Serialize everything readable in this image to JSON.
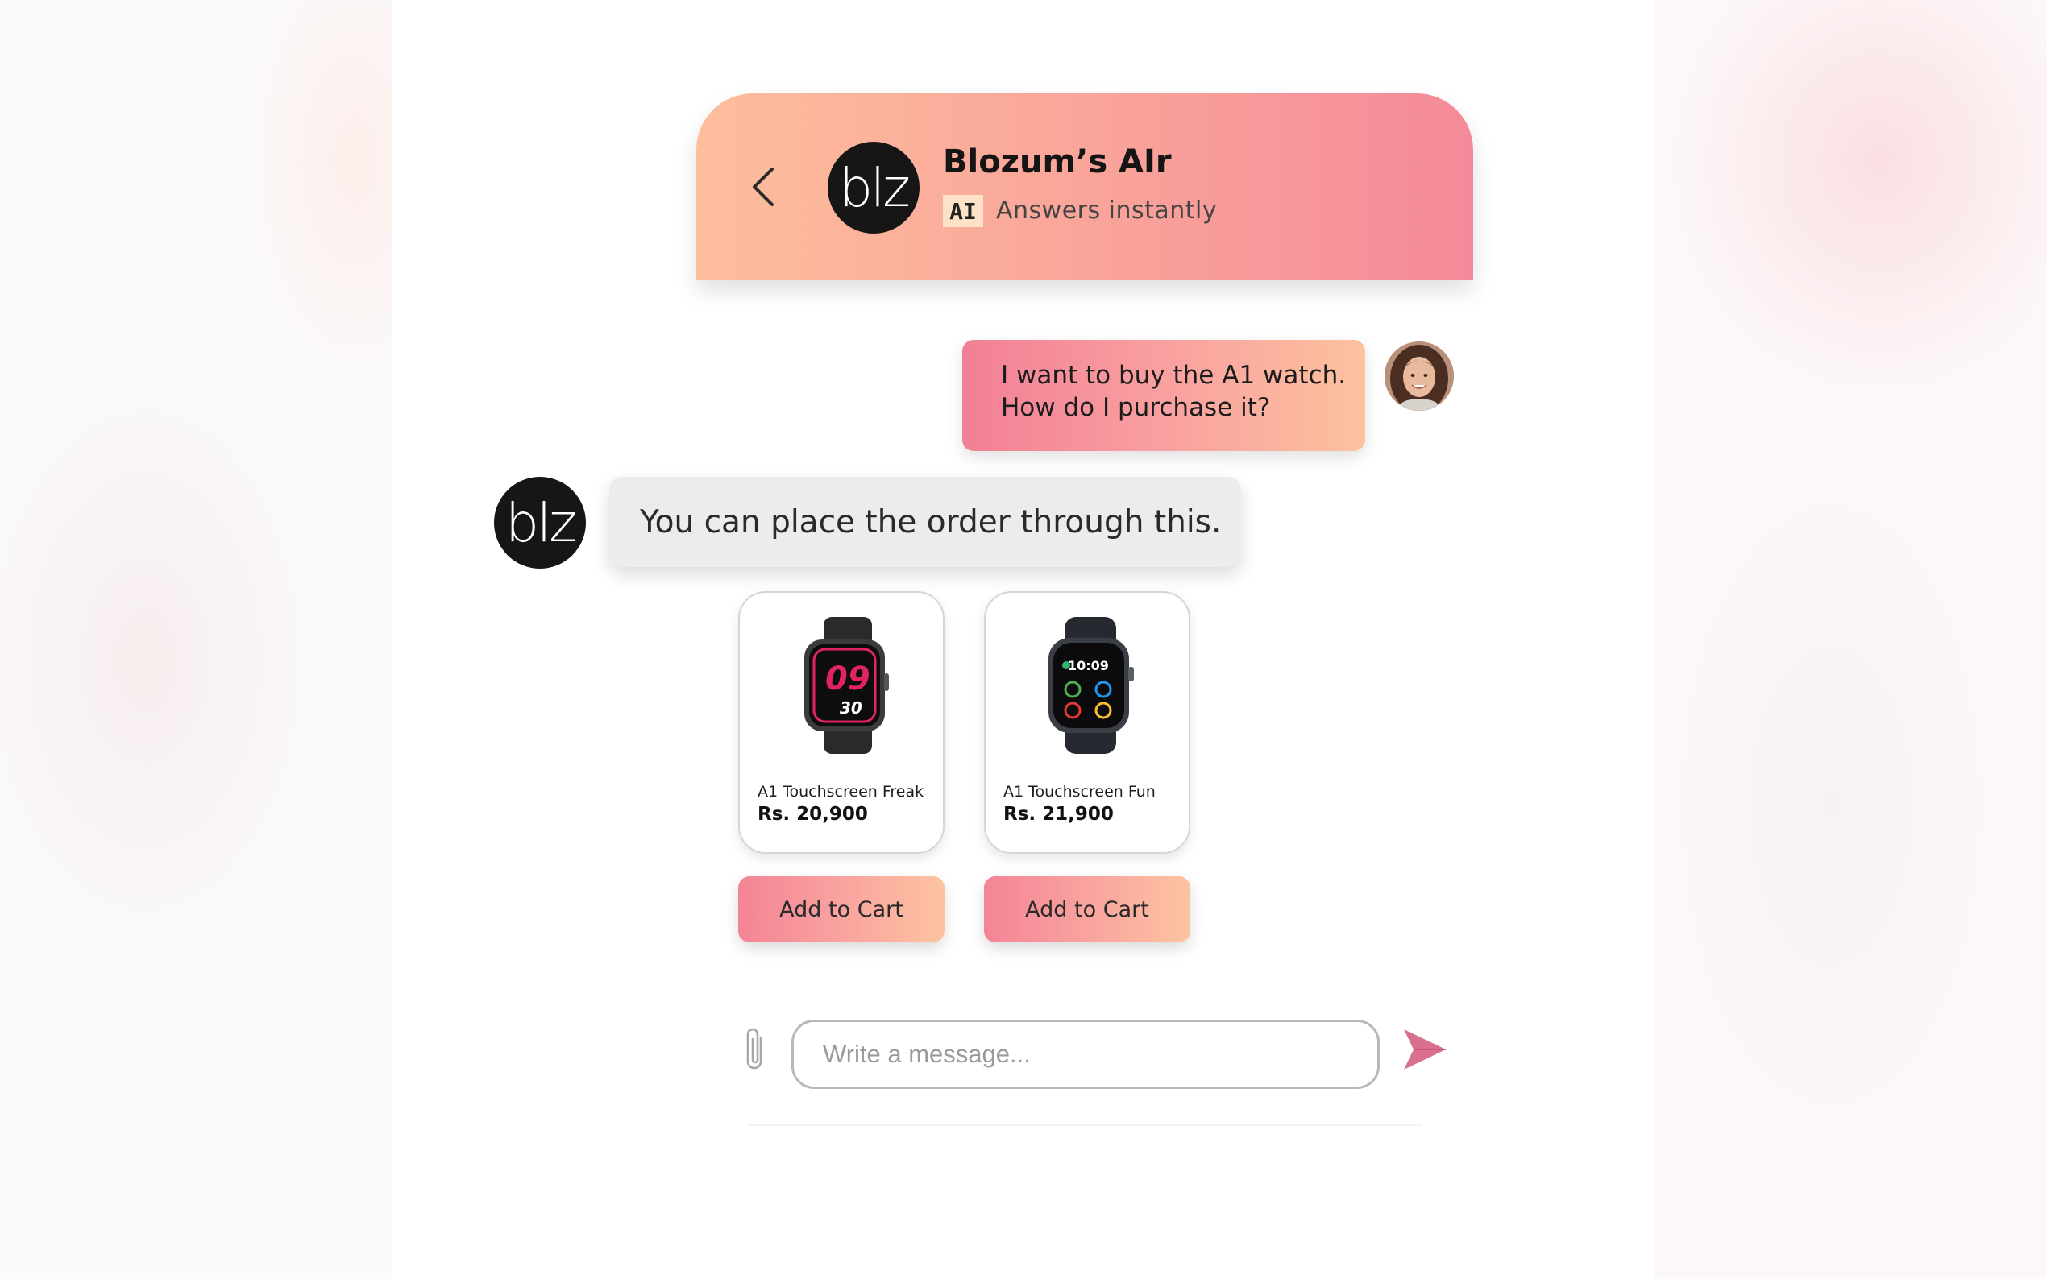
{
  "header": {
    "title": "Blozum’s AIr",
    "ai_badge": "AI",
    "subtitle": "Answers instantly",
    "logo_text": "blz"
  },
  "messages": {
    "user": {
      "line1": "I want to buy the A1 watch.",
      "line2": "How do I purchase it?"
    },
    "bot": {
      "avatar_text": "blz",
      "text": "You can place the order through this."
    }
  },
  "products": [
    {
      "name": "A1 Touchscreen Freak",
      "price": "Rs. 20,900",
      "watch_time_top": "09",
      "watch_time_bottom": "30",
      "button_label": "Add to Cart"
    },
    {
      "name": "A1 Touchscreen Fun",
      "price": "Rs. 21,900",
      "watch_time": "10:09",
      "button_label": "Add to Cart"
    }
  ],
  "composer": {
    "placeholder": "Write a message..."
  },
  "icons": {
    "back": "chevron-left-icon",
    "attach": "paperclip-icon",
    "send": "send-icon"
  },
  "colors": {
    "header_gradient": [
      "#fdbe9c",
      "#f48a99"
    ],
    "bubble_gradient": [
      "#f27f95",
      "#fdc29e"
    ],
    "send_icon": "#d9708f"
  }
}
